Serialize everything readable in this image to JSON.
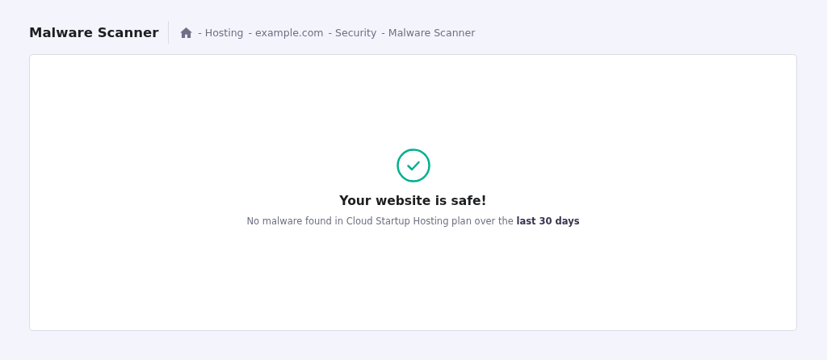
{
  "header": {
    "title": "Malware Scanner",
    "breadcrumb": {
      "separator": "-",
      "items": [
        "Hosting",
        "example.com",
        "Security",
        "Malware Scanner"
      ]
    }
  },
  "status": {
    "heading": "Your website is safe!",
    "message": "No malware found in Cloud Startup Hosting plan over the **last 30 days**"
  }
}
